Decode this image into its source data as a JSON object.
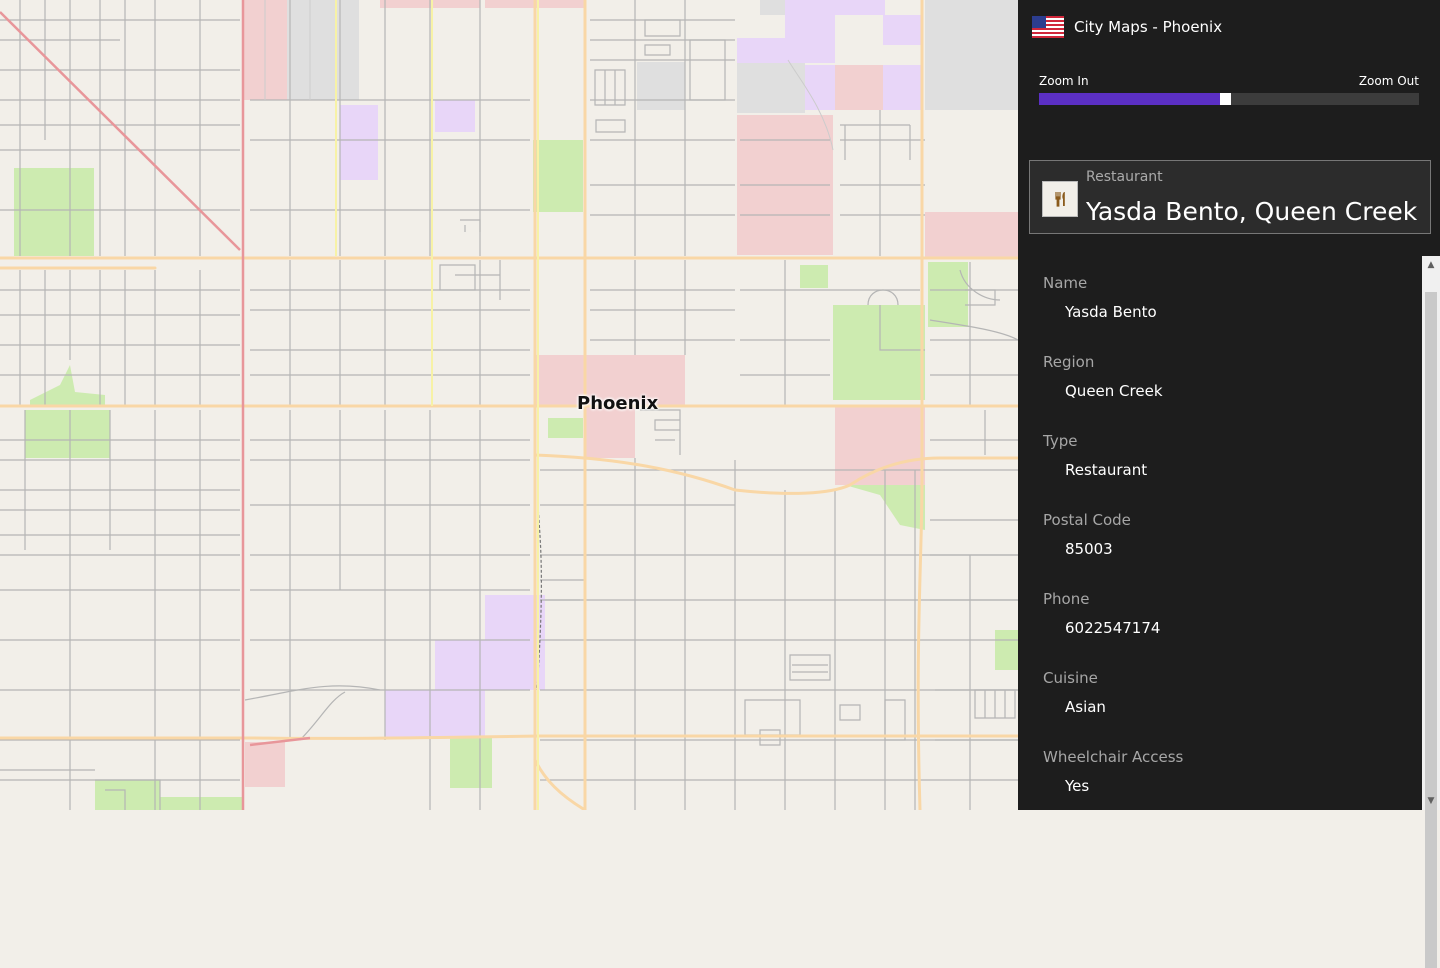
{
  "map": {
    "city_label": "Phoenix"
  },
  "panel": {
    "app_title": "City Maps - Phoenix",
    "flag_icon": "us-flag-icon",
    "zoom": {
      "in_label": "Zoom In",
      "out_label": "Zoom Out",
      "level": 0.49
    },
    "place": {
      "category": "Restaurant",
      "name": "Yasda Bento, Queen Creek",
      "icon": "restaurant-icon"
    },
    "details": [
      {
        "label": "Name",
        "value": "Yasda Bento"
      },
      {
        "label": "Region",
        "value": "Queen Creek"
      },
      {
        "label": "Type",
        "value": "Restaurant"
      },
      {
        "label": "Postal Code",
        "value": "85003"
      },
      {
        "label": "Phone",
        "value": "6022547174"
      },
      {
        "label": "Cuisine",
        "value": "Asian"
      },
      {
        "label": "Wheelchair Access",
        "value": "Yes"
      }
    ]
  },
  "colors": {
    "map_background": "#f2efe9",
    "panel_background": "#1d1d1d",
    "zoom_fill": "#5b2fc4",
    "park": "#cdebb0",
    "commercial": "#f2d0d0",
    "institutional": "#e8d6f8",
    "industrial": "#dfdfdf",
    "major_road": "#f9d7a6",
    "primary_road": "#e8969a"
  }
}
